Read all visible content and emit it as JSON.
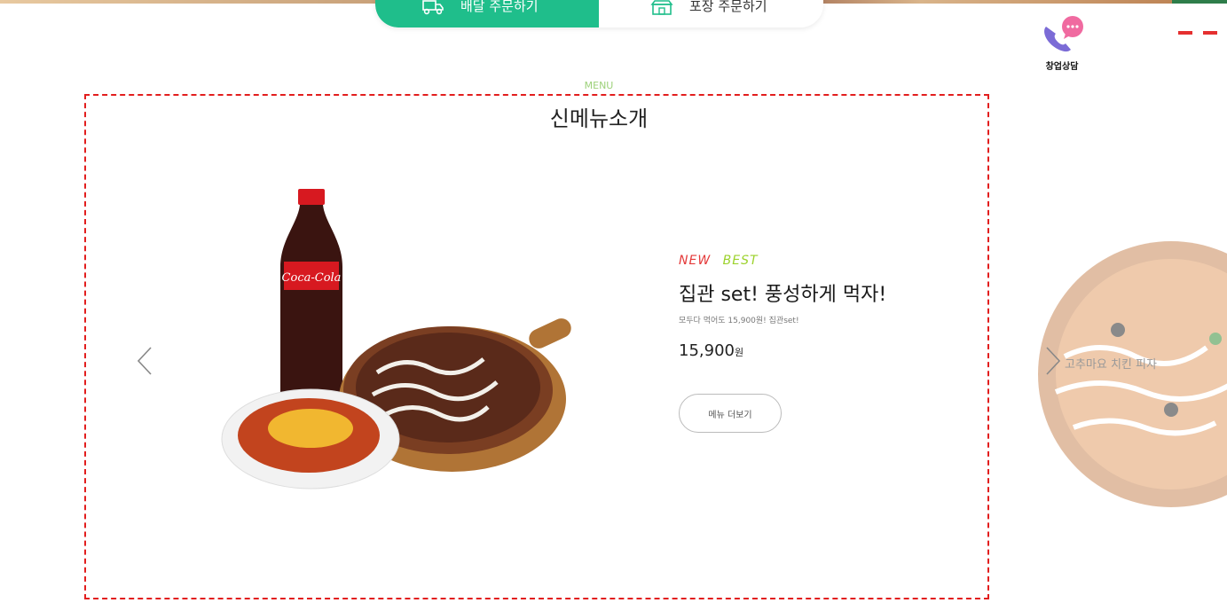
{
  "order_bar": {
    "delivery_label": "배달 주문하기",
    "pickup_label": "포장 주문하기"
  },
  "consult": {
    "label": "창업상담"
  },
  "section": {
    "eyebrow": "MENU",
    "title": "신메뉴소개"
  },
  "product": {
    "tags": [
      "NEW",
      "BEST"
    ],
    "name": "집관 set! 풍성하게 먹자!",
    "description": "모두다 먹어도 15,900원! 집관set!",
    "price": "15,900",
    "price_unit": "원",
    "more_button": "메뉴 더보기"
  },
  "next_product": {
    "name": "고추마요 치킨 피자"
  },
  "colors": {
    "delivery": "#1fbe8b",
    "frame": "#e21e1e",
    "tag_new": "#e43a3a",
    "tag_best": "#9cd22c"
  },
  "icons": [
    "delivery-scooter-icon",
    "store-pickup-icon",
    "phone-chat-icon",
    "chevron-left-icon",
    "chevron-right-icon"
  ]
}
